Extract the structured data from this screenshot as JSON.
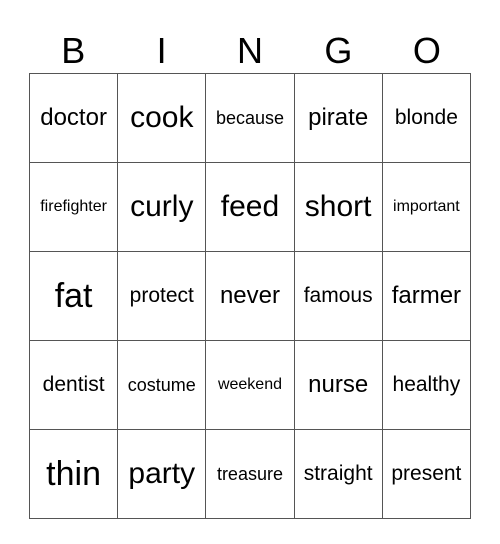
{
  "header": {
    "letters": [
      "B",
      "I",
      "N",
      "G",
      "O"
    ]
  },
  "card": {
    "rows": [
      [
        "doctor",
        "cook",
        "because",
        "pirate",
        "blonde"
      ],
      [
        "firefighter",
        "curly",
        "feed",
        "short",
        "important"
      ],
      [
        "fat",
        "protect",
        "never",
        "famous",
        "farmer"
      ],
      [
        "dentist",
        "costume",
        "weekend",
        "nurse",
        "healthy"
      ],
      [
        "thin",
        "party",
        "treasure",
        "straight",
        "present"
      ]
    ]
  }
}
